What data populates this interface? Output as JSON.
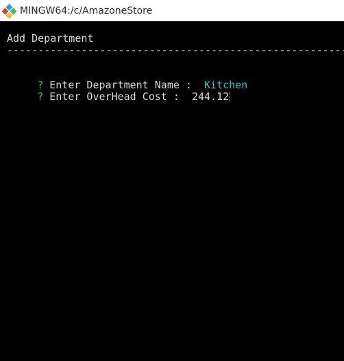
{
  "window": {
    "title": "MINGW64:/c/AmazoneStore",
    "icon": "git-bash-icon"
  },
  "terminal": {
    "heading": "Add Department",
    "rule": "--------------------------------------------------------------------------------",
    "prompts": [
      {
        "marker": "?",
        "label": " Enter Department Name :  ",
        "value": "Kitchen"
      },
      {
        "marker": "?",
        "label": " Enter OverHead Cost :  ",
        "value": "244.12"
      }
    ]
  },
  "colors": {
    "background": "#000000",
    "text": "#d9d9d9",
    "prompt_marker": "#3cc43c",
    "answer_highlight": "#2bc4c4"
  }
}
